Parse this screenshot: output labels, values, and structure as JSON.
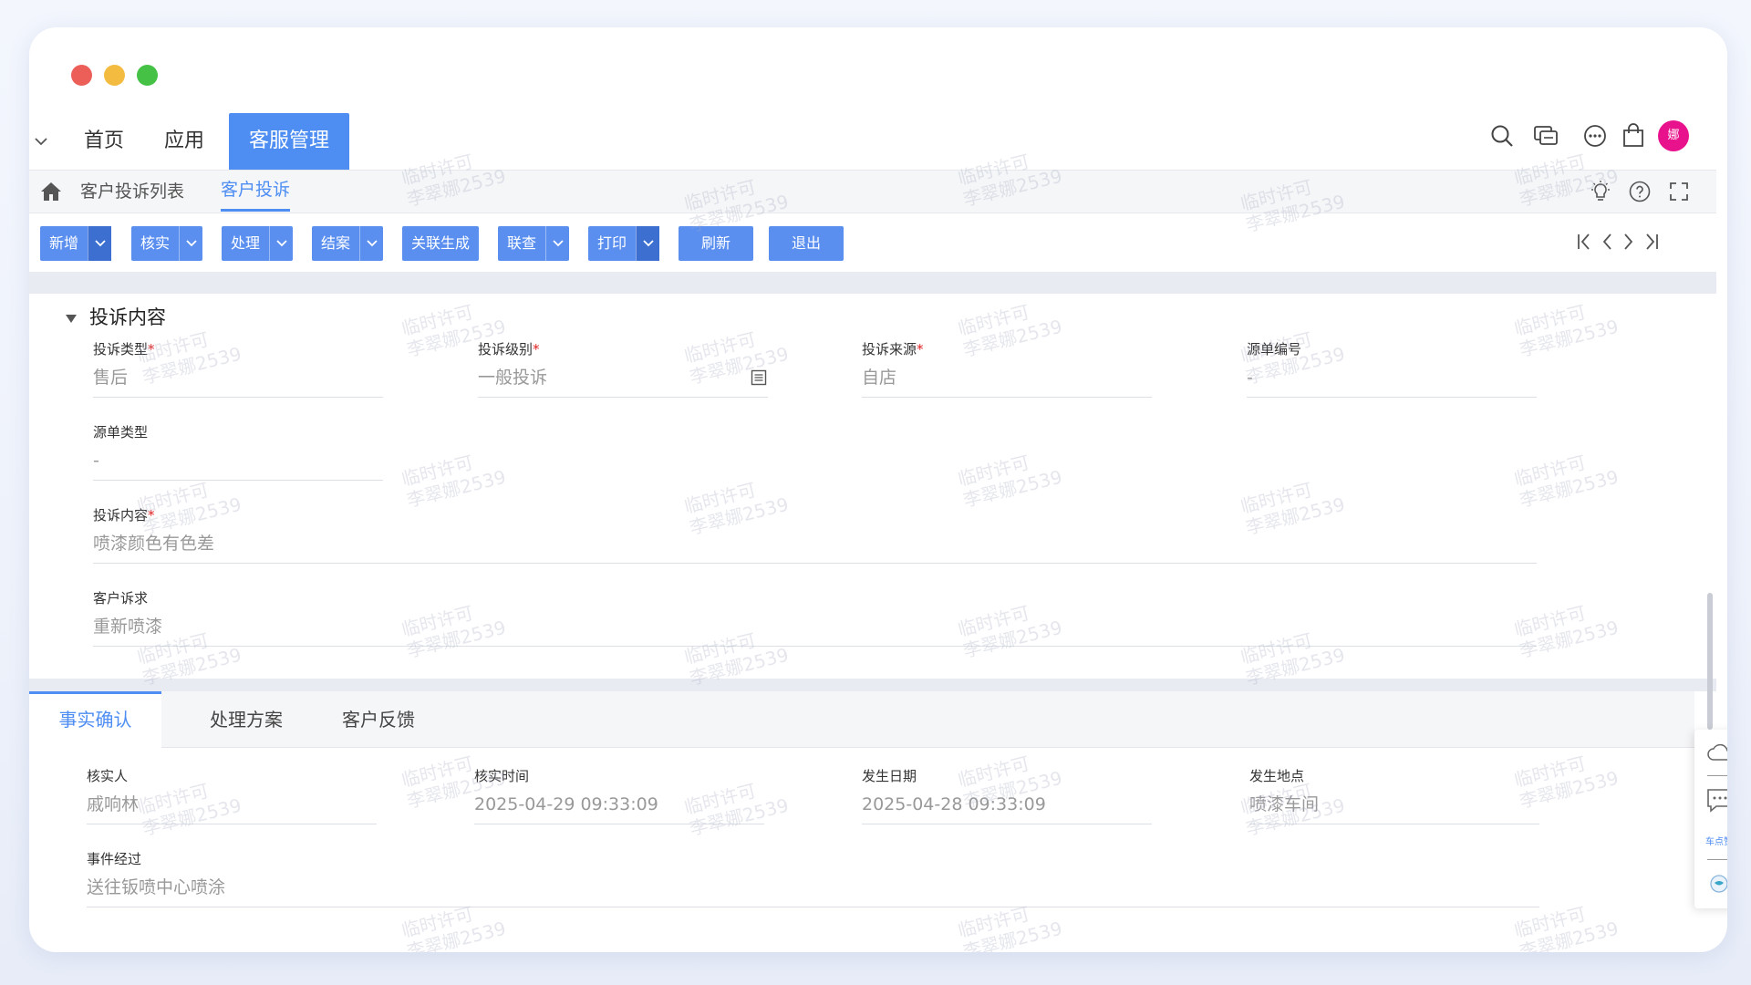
{
  "app": {
    "colors": {
      "accent": "#4e8df2",
      "button": "#5a8ff0",
      "avatar": "#e8138c",
      "required": "#e02020"
    }
  },
  "topnav": {
    "items": [
      {
        "label": "首页"
      },
      {
        "label": "应用"
      },
      {
        "label": "客服管理"
      }
    ],
    "avatar_text": "娜"
  },
  "breadcrumb": {
    "items": [
      {
        "label": "客户投诉列表"
      },
      {
        "label": "客户投诉"
      }
    ]
  },
  "toolbar": {
    "buttons": [
      {
        "label": "新增",
        "dropdown": true
      },
      {
        "label": "核实",
        "dropdown": true
      },
      {
        "label": "处理",
        "dropdown": true
      },
      {
        "label": "结案",
        "dropdown": true
      },
      {
        "label": "关联生成",
        "dropdown": false
      },
      {
        "label": "联查",
        "dropdown": true
      },
      {
        "label": "打印",
        "dropdown": true
      },
      {
        "label": "刷新",
        "dropdown": false
      },
      {
        "label": "退出",
        "dropdown": false
      }
    ]
  },
  "complaint": {
    "section_title": "投诉内容",
    "fields": {
      "type": {
        "label": "投诉类型",
        "required": "*",
        "value": "售后"
      },
      "level": {
        "label": "投诉级别",
        "required": "*",
        "value": "一般投诉"
      },
      "source": {
        "label": "投诉来源",
        "required": "*",
        "value": "自店"
      },
      "source_no": {
        "label": "源单编号",
        "value": "-"
      },
      "source_type": {
        "label": "源单类型",
        "value": "-"
      },
      "content": {
        "label": "投诉内容",
        "required": "*",
        "value": "喷漆颜色有色差"
      },
      "demand": {
        "label": "客户诉求",
        "value": "重新喷漆"
      }
    }
  },
  "tabs": [
    {
      "label": "事实确认"
    },
    {
      "label": "处理方案"
    },
    {
      "label": "客户反馈"
    }
  ],
  "facts": {
    "verifier": {
      "label": "核实人",
      "value": "戚响林"
    },
    "verify_time": {
      "label": "核实时间",
      "value": "2025-04-29 09:33:09"
    },
    "occur_date": {
      "label": "发生日期",
      "value": "2025-04-28 09:33:09"
    },
    "location": {
      "label": "发生地点",
      "value": "喷漆车间"
    },
    "process": {
      "label": "事件经过",
      "value": "送往钣喷中心喷涂"
    }
  },
  "float_panel": {
    "label": "车点赞"
  },
  "watermark": {
    "line1": "临时许可",
    "line2": "李翠娜2539"
  }
}
